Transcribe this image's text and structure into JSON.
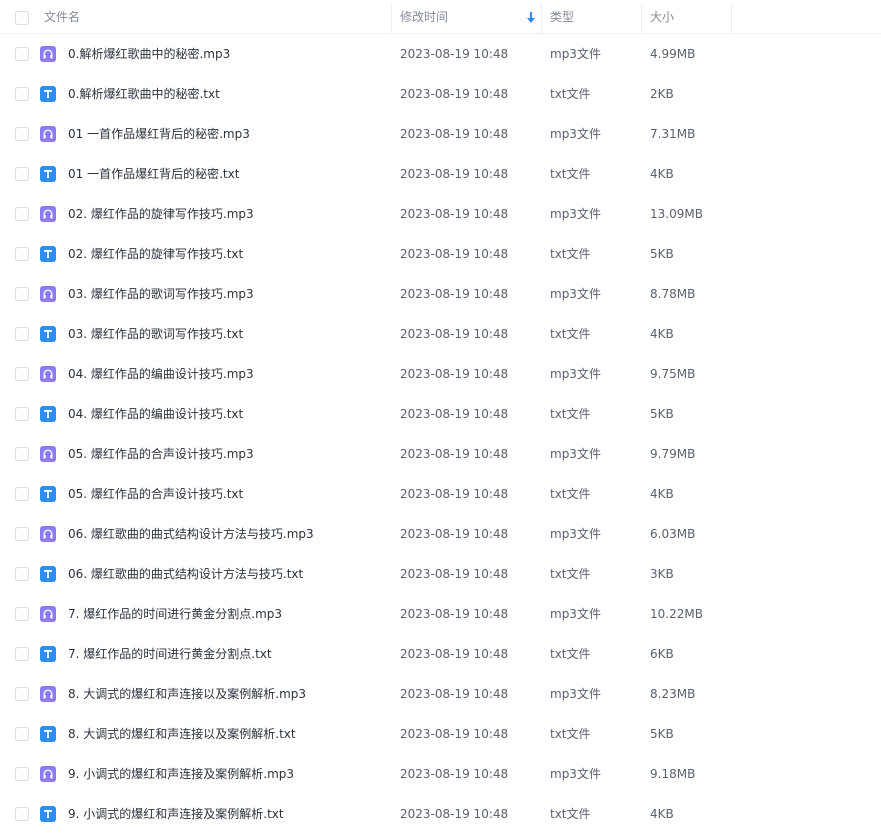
{
  "header": {
    "name": "文件名",
    "modified": "修改时间",
    "type": "类型",
    "size": "大小"
  },
  "files": [
    {
      "name": "0.解析爆红歌曲中的秘密.mp3",
      "modified": "2023-08-19 10:48",
      "type": "mp3文件",
      "size": "4.99MB",
      "kind": "mp3"
    },
    {
      "name": "0.解析爆红歌曲中的秘密.txt",
      "modified": "2023-08-19 10:48",
      "type": "txt文件",
      "size": "2KB",
      "kind": "txt"
    },
    {
      "name": "01 一首作品爆红背后的秘密.mp3",
      "modified": "2023-08-19 10:48",
      "type": "mp3文件",
      "size": "7.31MB",
      "kind": "mp3"
    },
    {
      "name": "01 一首作品爆红背后的秘密.txt",
      "modified": "2023-08-19 10:48",
      "type": "txt文件",
      "size": "4KB",
      "kind": "txt"
    },
    {
      "name": "02. 爆红作品的旋律写作技巧.mp3",
      "modified": "2023-08-19 10:48",
      "type": "mp3文件",
      "size": "13.09MB",
      "kind": "mp3"
    },
    {
      "name": "02. 爆红作品的旋律写作技巧.txt",
      "modified": "2023-08-19 10:48",
      "type": "txt文件",
      "size": "5KB",
      "kind": "txt"
    },
    {
      "name": "03. 爆红作品的歌词写作技巧.mp3",
      "modified": "2023-08-19 10:48",
      "type": "mp3文件",
      "size": "8.78MB",
      "kind": "mp3"
    },
    {
      "name": "03. 爆红作品的歌词写作技巧.txt",
      "modified": "2023-08-19 10:48",
      "type": "txt文件",
      "size": "4KB",
      "kind": "txt"
    },
    {
      "name": "04. 爆红作品的编曲设计技巧.mp3",
      "modified": "2023-08-19 10:48",
      "type": "mp3文件",
      "size": "9.75MB",
      "kind": "mp3"
    },
    {
      "name": "04. 爆红作品的编曲设计技巧.txt",
      "modified": "2023-08-19 10:48",
      "type": "txt文件",
      "size": "5KB",
      "kind": "txt"
    },
    {
      "name": "05. 爆红作品的合声设计技巧.mp3",
      "modified": "2023-08-19 10:48",
      "type": "mp3文件",
      "size": "9.79MB",
      "kind": "mp3"
    },
    {
      "name": "05. 爆红作品的合声设计技巧.txt",
      "modified": "2023-08-19 10:48",
      "type": "txt文件",
      "size": "4KB",
      "kind": "txt"
    },
    {
      "name": "06. 爆红歌曲的曲式结构设计方法与技巧.mp3",
      "modified": "2023-08-19 10:48",
      "type": "mp3文件",
      "size": "6.03MB",
      "kind": "mp3"
    },
    {
      "name": "06. 爆红歌曲的曲式结构设计方法与技巧.txt",
      "modified": "2023-08-19 10:48",
      "type": "txt文件",
      "size": "3KB",
      "kind": "txt"
    },
    {
      "name": "7. 爆红作品的时间进行黄金分割点.mp3",
      "modified": "2023-08-19 10:48",
      "type": "mp3文件",
      "size": "10.22MB",
      "kind": "mp3"
    },
    {
      "name": "7. 爆红作品的时间进行黄金分割点.txt",
      "modified": "2023-08-19 10:48",
      "type": "txt文件",
      "size": "6KB",
      "kind": "txt"
    },
    {
      "name": "8. 大调式的爆红和声连接以及案例解析.mp3",
      "modified": "2023-08-19 10:48",
      "type": "mp3文件",
      "size": "8.23MB",
      "kind": "mp3"
    },
    {
      "name": "8. 大调式的爆红和声连接以及案例解析.txt",
      "modified": "2023-08-19 10:48",
      "type": "txt文件",
      "size": "5KB",
      "kind": "txt"
    },
    {
      "name": "9. 小调式的爆红和声连接及案例解析.mp3",
      "modified": "2023-08-19 10:48",
      "type": "mp3文件",
      "size": "9.18MB",
      "kind": "mp3"
    },
    {
      "name": "9. 小调式的爆红和声连接及案例解析.txt",
      "modified": "2023-08-19 10:48",
      "type": "txt文件",
      "size": "4KB",
      "kind": "txt"
    }
  ],
  "icons": {
    "mp3": "headphones-icon",
    "txt": "text-file-icon",
    "sort": "sort-down-arrow-icon"
  },
  "colors": {
    "mp3_icon": "#8a7cf0",
    "txt_icon": "#2f8cf5",
    "sort_arrow": "#2f8cf5"
  }
}
